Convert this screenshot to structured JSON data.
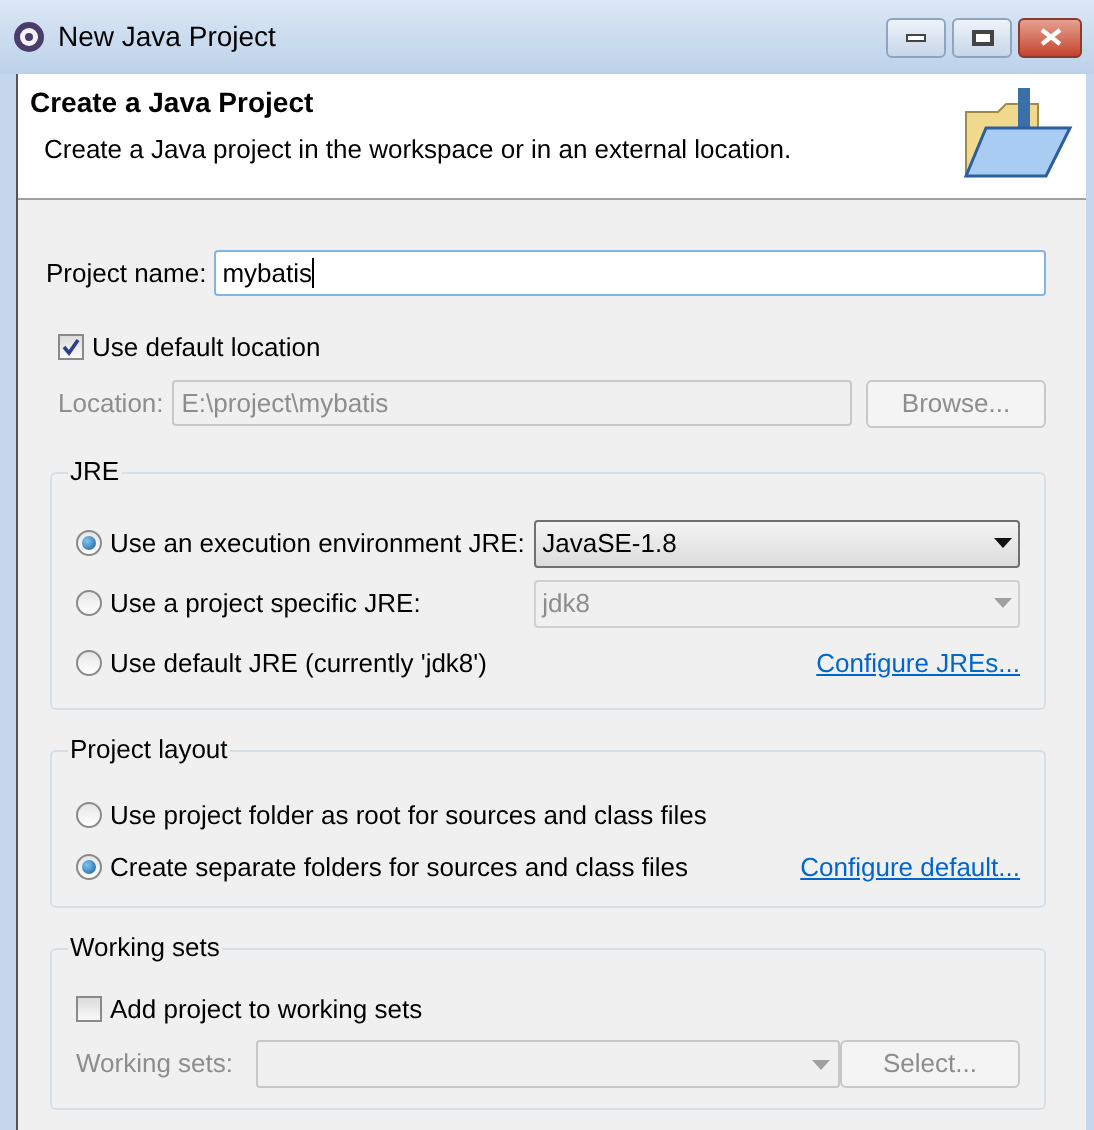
{
  "window": {
    "title": "New Java Project"
  },
  "header": {
    "title": "Create a Java Project",
    "description": "Create a Java project in the workspace or in an external location."
  },
  "project_name": {
    "label": "Project name:",
    "value": "mybatis"
  },
  "default_location": {
    "label": "Use default location",
    "checked": true
  },
  "location": {
    "label": "Location:",
    "value": "E:\\project\\mybatis",
    "disabled": true,
    "button": "Browse..."
  },
  "jre": {
    "title": "JRE",
    "options": [
      {
        "label": "Use an execution environment JRE:",
        "selected": true,
        "select": {
          "value": "JavaSE-1.8",
          "disabled": false
        }
      },
      {
        "label": "Use a project specific JRE:",
        "selected": false,
        "select": {
          "value": "jdk8",
          "disabled": true
        }
      },
      {
        "label": "Use default JRE (currently 'jdk8')",
        "selected": false,
        "link": "Configure JREs..."
      }
    ]
  },
  "project_layout": {
    "title": "Project layout",
    "options": [
      {
        "label": "Use project folder as root for sources and class files",
        "selected": false
      },
      {
        "label": "Create separate folders for sources and class files",
        "selected": true,
        "link": "Configure default..."
      }
    ]
  },
  "working_sets": {
    "title": "Working sets",
    "add": {
      "label": "Add project to working sets",
      "checked": false
    },
    "field_label": "Working sets:",
    "disabled": true,
    "button": "Select..."
  }
}
